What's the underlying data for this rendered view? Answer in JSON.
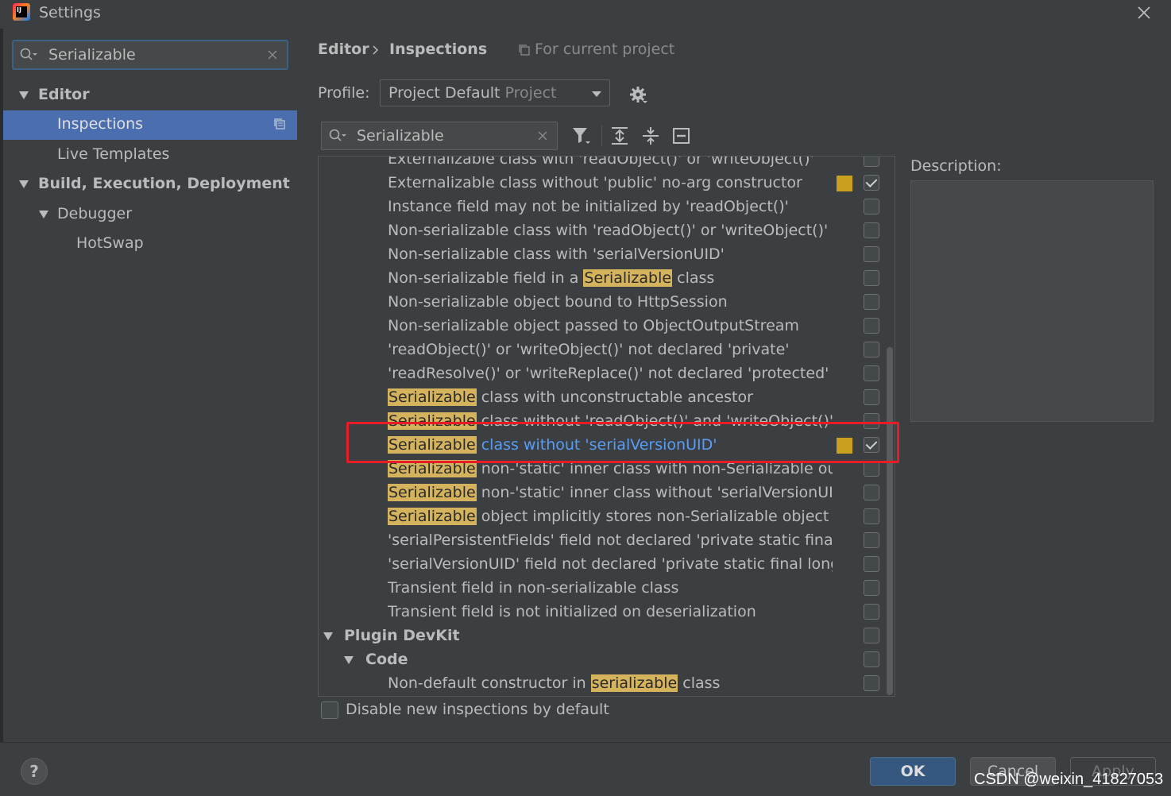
{
  "window": {
    "title": "Settings"
  },
  "sidebar": {
    "search_value": "Serializable",
    "items": [
      {
        "label": "Editor"
      },
      {
        "label": "Inspections"
      },
      {
        "label": "Live Templates"
      },
      {
        "label": "Build, Execution, Deployment"
      },
      {
        "label": "Debugger"
      },
      {
        "label": "HotSwap"
      }
    ]
  },
  "header": {
    "breadcrumb": [
      "Editor",
      "Inspections"
    ],
    "scope_note": "For current project"
  },
  "profile": {
    "label": "Profile:",
    "value": "Project Default",
    "sub": "Project"
  },
  "filter": {
    "value": "Serializable"
  },
  "inspections": [
    {
      "pre": "Externalizable class with 'readObject()' or 'writeObject()'",
      "hl": "",
      "post": "",
      "checked": false,
      "severity": false
    },
    {
      "pre": "Externalizable class without 'public' no-arg constructor",
      "hl": "",
      "post": "",
      "checked": true,
      "severity": true
    },
    {
      "pre": "Instance field may not be initialized by 'readObject()'",
      "hl": "",
      "post": "",
      "checked": false,
      "severity": false
    },
    {
      "pre": "Non-serializable class with 'readObject()' or 'writeObject()'",
      "hl": "",
      "post": "",
      "checked": false,
      "severity": false
    },
    {
      "pre": "Non-serializable class with 'serialVersionUID'",
      "hl": "",
      "post": "",
      "checked": false,
      "severity": false
    },
    {
      "pre": "Non-serializable field in a ",
      "hl": "Serializable",
      "post": " class",
      "checked": false,
      "severity": false
    },
    {
      "pre": "Non-serializable object bound to HttpSession",
      "hl": "",
      "post": "",
      "checked": false,
      "severity": false
    },
    {
      "pre": "Non-serializable object passed to ObjectOutputStream",
      "hl": "",
      "post": "",
      "checked": false,
      "severity": false
    },
    {
      "pre": "'readObject()' or 'writeObject()' not declared 'private'",
      "hl": "",
      "post": "",
      "checked": false,
      "severity": false
    },
    {
      "pre": "'readResolve()' or 'writeReplace()' not declared 'protected'",
      "hl": "",
      "post": "",
      "checked": false,
      "severity": false
    },
    {
      "pre": "",
      "hl": "Serializable",
      "post": " class with unconstructable ancestor",
      "checked": false,
      "severity": false
    },
    {
      "pre": "",
      "hl": "Serializable",
      "post": " class without 'readObject()' and 'writeObject()'",
      "checked": false,
      "severity": false
    },
    {
      "pre": "",
      "hl": "Serializable",
      "post": " class without 'serialVersionUID'",
      "checked": true,
      "severity": true,
      "selected": true
    },
    {
      "pre": "",
      "hl": "Serializable",
      "post": " non-'static' inner class with non-Serializable outer cla",
      "checked": false,
      "severity": false
    },
    {
      "pre": "",
      "hl": "Serializable",
      "post": " non-'static' inner class without 'serialVersionUID'",
      "checked": false,
      "severity": false
    },
    {
      "pre": "",
      "hl": "Serializable",
      "post": " object implicitly stores non-Serializable object",
      "checked": false,
      "severity": false
    },
    {
      "pre": "'serialPersistentFields' field not declared 'private static final Objec",
      "hl": "",
      "post": "",
      "checked": false,
      "severity": false
    },
    {
      "pre": "'serialVersionUID' field not declared 'private static final long'",
      "hl": "",
      "post": "",
      "checked": false,
      "severity": false
    },
    {
      "pre": "Transient field in non-serializable class",
      "hl": "",
      "post": "",
      "checked": false,
      "severity": false
    },
    {
      "pre": "Transient field is not initialized on deserialization",
      "hl": "",
      "post": "",
      "checked": false,
      "severity": false
    }
  ],
  "groups": [
    {
      "label": "Plugin DevKit"
    },
    {
      "label": "Code"
    }
  ],
  "devkit_item": {
    "pre": "Non-default constructor in ",
    "hl": "serializable",
    "post": " class",
    "checked": false
  },
  "description": {
    "label": "Description:"
  },
  "footer": {
    "disable_label": "Disable new inspections by default",
    "help": "?",
    "ok": "OK",
    "cancel": "Cancel",
    "apply": "Apply"
  },
  "watermark": "CSDN @weixin_41827053",
  "colors": {
    "selection": "#4b6eaf",
    "highlight": "#d4b35c",
    "severity": "#c8a01e",
    "annotation": "#e81c24",
    "link": "#589df6"
  },
  "icons": [
    "app-icon",
    "close-icon",
    "search-icon",
    "clear-icon",
    "gear-icon",
    "filter-icon",
    "expand-all-icon",
    "collapse-all-icon",
    "reset-icon",
    "copy-icon"
  ]
}
